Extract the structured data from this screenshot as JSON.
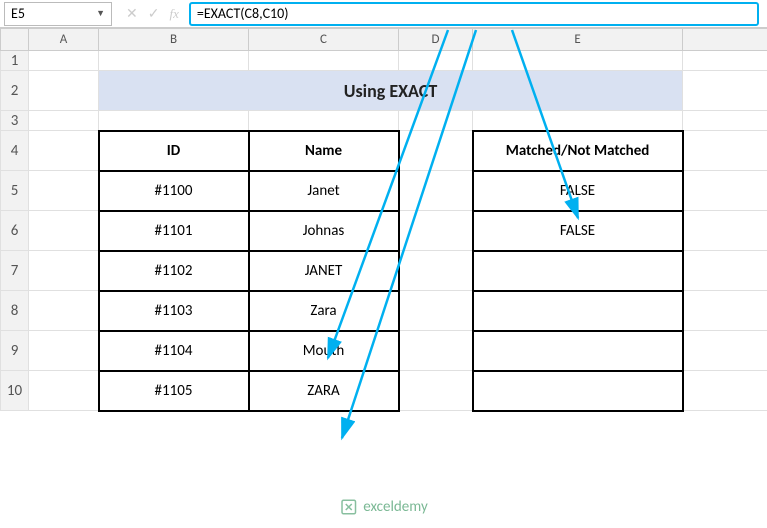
{
  "name_box": "E5",
  "formula": "=EXACT(C8,C10)",
  "columns": [
    "A",
    "B",
    "C",
    "D",
    "E"
  ],
  "row_numbers": [
    "1",
    "2",
    "3",
    "4",
    "5",
    "6",
    "7",
    "8",
    "9",
    "10"
  ],
  "title": "Using EXACT",
  "headers": {
    "id": "ID",
    "name": "Name",
    "matched": "Matched/Not Matched"
  },
  "rows": [
    {
      "id": "#1100",
      "name": "Janet",
      "matched": "FALSE"
    },
    {
      "id": "#1101",
      "name": "Johnas",
      "matched": "FALSE"
    },
    {
      "id": "#1102",
      "name": "JANET",
      "matched": ""
    },
    {
      "id": "#1103",
      "name": "Zara",
      "matched": ""
    },
    {
      "id": "#1104",
      "name": "Mouth",
      "matched": ""
    },
    {
      "id": "#1105",
      "name": "ZARA",
      "matched": ""
    }
  ],
  "watermark": "exceldemy",
  "chart_data": {
    "type": "table",
    "title": "Using EXACT",
    "columns": [
      "ID",
      "Name",
      "Matched/Not Matched"
    ],
    "rows": [
      [
        "#1100",
        "Janet",
        "FALSE"
      ],
      [
        "#1101",
        "Johnas",
        "FALSE"
      ],
      [
        "#1102",
        "JANET",
        ""
      ],
      [
        "#1103",
        "Zara",
        ""
      ],
      [
        "#1104",
        "Mouth",
        ""
      ],
      [
        "#1105",
        "ZARA",
        ""
      ]
    ],
    "formula_bar": "=EXACT(C8,C10)",
    "active_cell": "E5"
  }
}
